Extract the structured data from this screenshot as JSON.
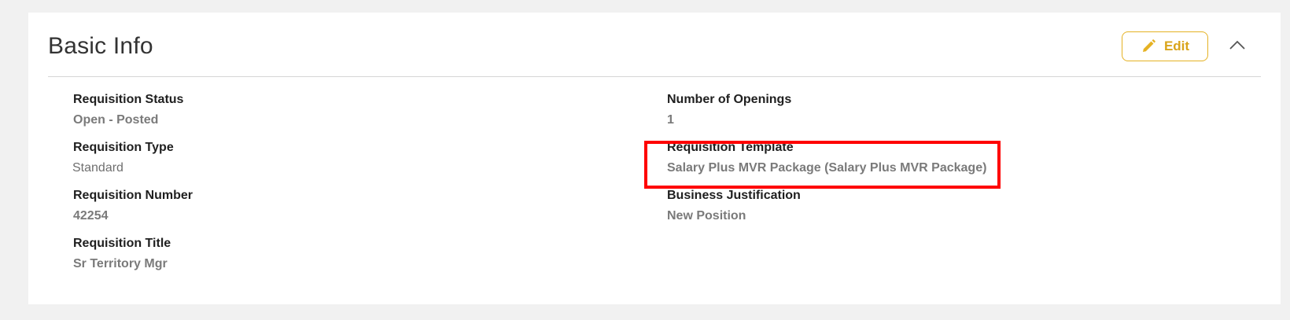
{
  "card": {
    "title": "Basic Info",
    "edit_label": "Edit",
    "icons": {
      "edit": "pencil-icon",
      "collapse": "chevron-up-icon"
    },
    "accent_color": "#e5b224",
    "highlight_color": "#ff0000"
  },
  "fields": {
    "left": [
      {
        "label": "Requisition Status",
        "value": "Open - Posted"
      },
      {
        "label": "Requisition Type",
        "value": "Standard"
      },
      {
        "label": "Requisition Number",
        "value": "42254"
      },
      {
        "label": "Requisition Title",
        "value": "Sr Territory Mgr"
      }
    ],
    "right": [
      {
        "label": "Number of Openings",
        "value": "1"
      },
      {
        "label": "Requisition Template",
        "value": "Salary Plus MVR Package (Salary Plus MVR Package)"
      },
      {
        "label": "Business Justification",
        "value": "New Position"
      }
    ]
  }
}
